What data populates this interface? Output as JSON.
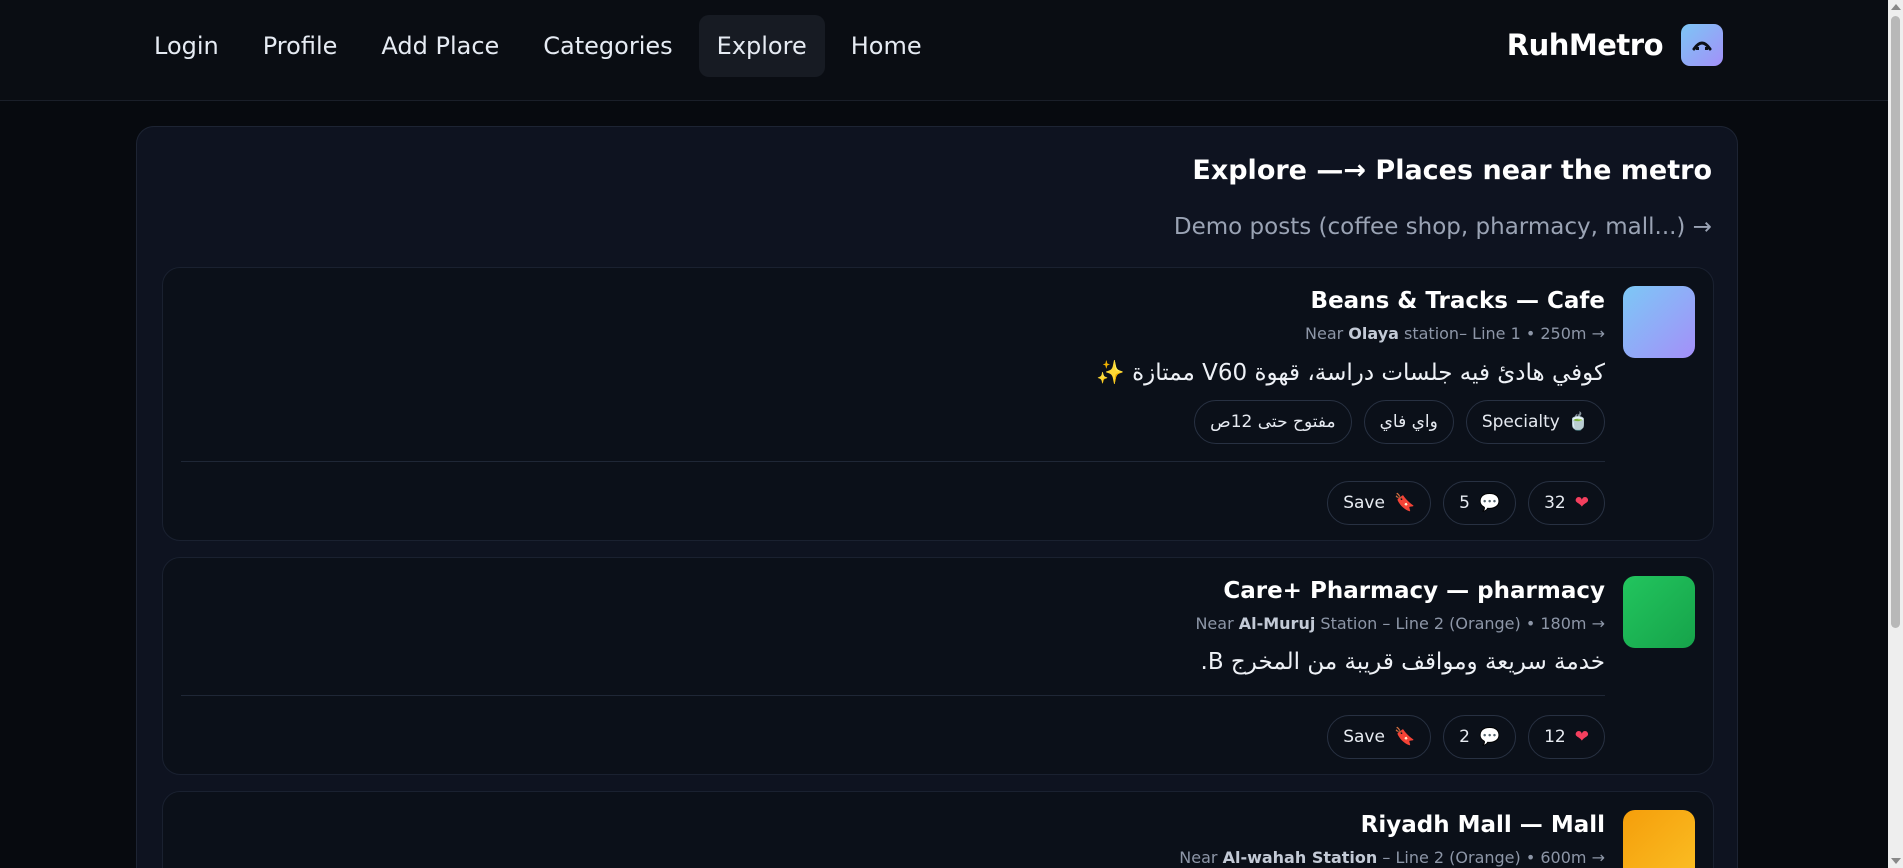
{
  "nav": {
    "items": [
      {
        "label": "Login"
      },
      {
        "label": "Profile"
      },
      {
        "label": "Add Place"
      },
      {
        "label": "Categories"
      },
      {
        "label": "Explore"
      },
      {
        "label": "Home"
      }
    ],
    "active": "Explore"
  },
  "brand": {
    "name": "RuhMetro",
    "logo_icon": "metro-icon"
  },
  "panel": {
    "title": "Explore —→ Places near the metro",
    "subtitle": "Demo posts (coffee shop, pharmacy, mall...) →"
  },
  "posts": [
    {
      "title": "Beans & Tracks — Cafe",
      "meta_prefix": "Near ",
      "station": "Olaya",
      "meta_suffix": " station– Line 1 • 250m →",
      "text": "كوفي هادئ فيه جلسات دراسة، قهوة V60 ممتازة ✨",
      "thumb_colors": [
        "#7cc8f6",
        "#a48ff9"
      ],
      "chips": [
        {
          "label": "Specialty",
          "icon": "🍵"
        },
        {
          "label": "واي فاي",
          "icon": ""
        },
        {
          "label": "مفتوح حتى 12ص",
          "icon": ""
        }
      ],
      "likes": "32",
      "comments": "5",
      "save_label": "Save"
    },
    {
      "title": "Care+ Pharmacy — pharmacy",
      "meta_prefix": "Near ",
      "station": "Al-Muruj",
      "meta_suffix": " Station – Line 2 (Orange) • 180m →",
      "text": "خدمة سريعة ومواقف قريبة من المخرج B.",
      "thumb_colors": [
        "#22c55e",
        "#16a34a"
      ],
      "chips": [],
      "likes": "12",
      "comments": "2",
      "save_label": "Save"
    },
    {
      "title": "Riyadh Mall — Mall",
      "meta_prefix": "Near ",
      "station": "Al-wahah Station",
      "meta_suffix": " – Line 2 (Orange) • 600m →",
      "thumb_colors": [
        "#f59e0b",
        "#fbbf24"
      ]
    }
  ],
  "colors": {
    "background": "#070a0f",
    "panel": "#0e1320",
    "card": "#0b1019",
    "like": "#f43f5e"
  }
}
